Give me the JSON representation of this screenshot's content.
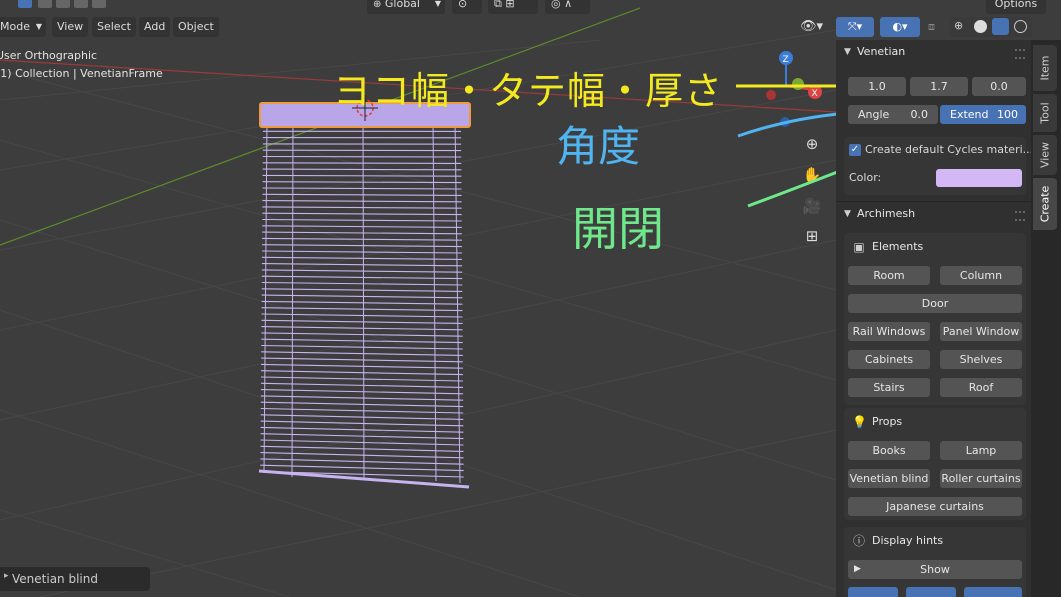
{
  "header": {
    "mode": "Mode",
    "menus": [
      "View",
      "Select",
      "Add",
      "Object"
    ],
    "orientation": "Global",
    "options": "Options"
  },
  "viewport": {
    "view_name": "User Orthographic",
    "collection": "(1) Collection | VenetianFrame",
    "operator_panel": "Venetian blind"
  },
  "annotations": {
    "dims_label": "ヨコ幅・タテ幅・厚さ",
    "angle_label": "角度",
    "open_close_label": "開閉"
  },
  "sidebar": {
    "tabs": [
      "Item",
      "Tool",
      "View",
      "Create"
    ],
    "venetian": {
      "title": "Venetian",
      "width": "1.0",
      "height": "1.7",
      "depth": "0.0",
      "angle_label": "Angle",
      "angle_value": "0.0",
      "extend_label": "Extend",
      "extend_value": "100",
      "create_material": "Create default Cycles materi...",
      "color_label": "Color:",
      "color_value": "#d4b8f5"
    },
    "archimesh": {
      "title": "Archimesh",
      "elements_title": "Elements",
      "elements": [
        "Room",
        "Column",
        "Door",
        "Rail Windows",
        "Panel Window",
        "Cabinets",
        "Shelves",
        "Stairs",
        "Roof"
      ],
      "props_title": "Props",
      "props": [
        "Books",
        "Lamp",
        "Venetian blind",
        "Roller curtains",
        "Japanese curtains"
      ],
      "hints_title": "Display hints",
      "show_label": "Show"
    }
  },
  "colors": {
    "selection_outline": "#f09a3e",
    "blind": "#c7b3f0",
    "annotation_yellow": "#f2ea1f",
    "annotation_blue": "#4fb4f0",
    "annotation_green": "#6ee88a"
  }
}
